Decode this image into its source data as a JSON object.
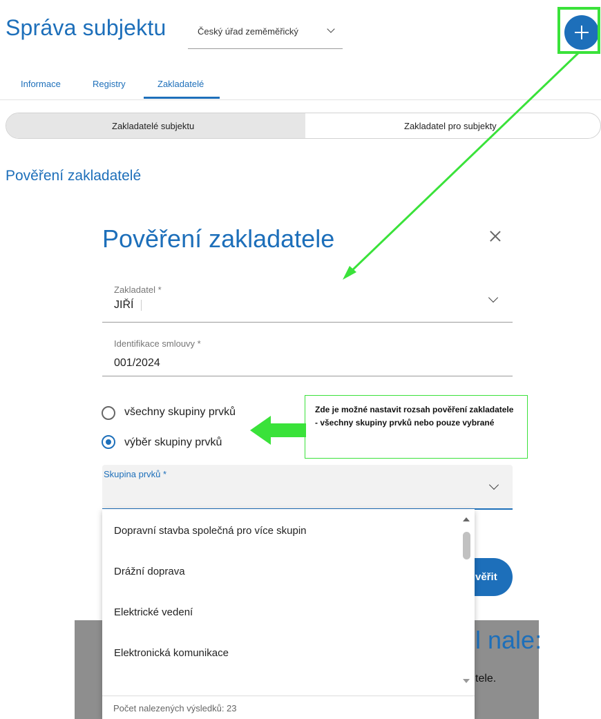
{
  "header": {
    "title": "Správa subjektu",
    "subject_select": {
      "value": "Český úřad zeměměřický",
      "icon": "chevron-down-icon"
    },
    "add_button": {
      "icon": "plus-icon"
    }
  },
  "tabs": [
    {
      "label": "Informace",
      "active": false
    },
    {
      "label": "Registry",
      "active": false
    },
    {
      "label": "Zakladatelé",
      "active": true
    }
  ],
  "segments": {
    "left": "Zakladatelé subjektu",
    "right": "Zakladatel pro subjekty",
    "selected": "left"
  },
  "section_title": "Pověření zakladatelé",
  "dialog": {
    "title": "Pověření zakladatele",
    "founder": {
      "label": "Zakladatel *",
      "value": "JIŘÍ"
    },
    "contract": {
      "label": "Identifikace smlouvy *",
      "value": "001/2024"
    },
    "scope_options": [
      {
        "label": "všechny skupiny prvků",
        "selected": false
      },
      {
        "label": "výběr skupiny prvků",
        "selected": true
      }
    ],
    "group_select": {
      "label": "Skupina prvků *",
      "value": ""
    },
    "confirm_button": "věřit"
  },
  "dropdown": {
    "options": [
      "Dopravní stavba společná pro více skupin",
      "Drážní doprava",
      "Elektrické vedení",
      "Elektronická komunikace"
    ],
    "footer": "Počet nalezených výsledků: 23"
  },
  "background": {
    "heading_fragment": "l nale:",
    "text_fragment": "tele."
  },
  "annotation": {
    "text": "Zde je možné nastavit rozsah pověření zakladatele -  všechny skupiny prvků nebo pouze vybrané",
    "highlight_color": "#3ae23a"
  },
  "colors": {
    "accent": "#1d6fba",
    "annotation_green": "#3ae23a",
    "overlay": "#8e8e8e"
  }
}
